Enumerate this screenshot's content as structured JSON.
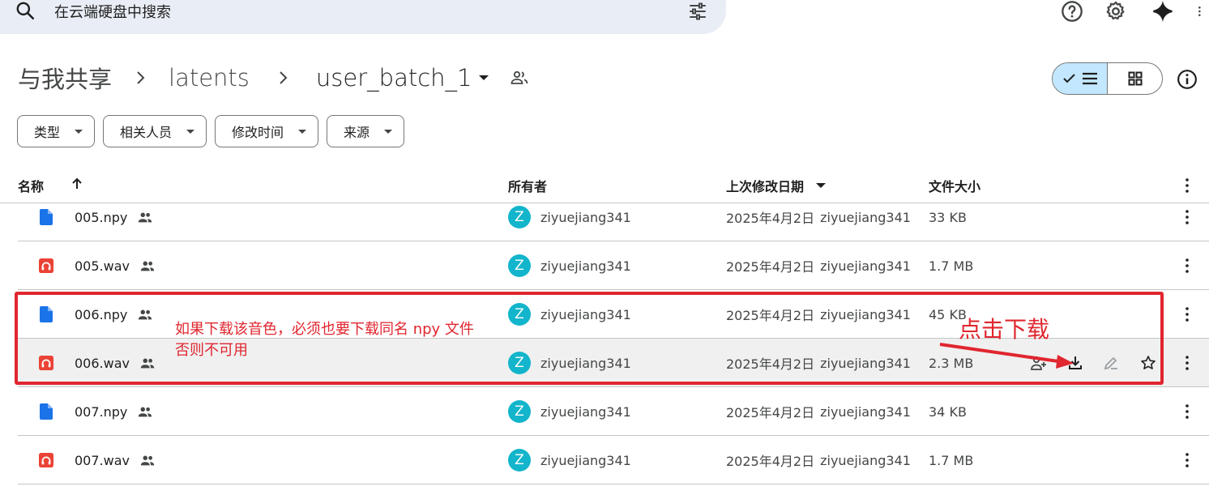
{
  "search": {
    "placeholder": "在云端硬盘中搜索"
  },
  "top_icons": [
    "search-icon",
    "tune-icon",
    "help-icon",
    "settings-icon",
    "gemini-icon",
    "apps-icon"
  ],
  "breadcrumb": {
    "items": [
      "与我共享",
      "latents",
      "user_batch_1"
    ]
  },
  "filters": [
    "类型",
    "相关人员",
    "修改时间",
    "来源"
  ],
  "table": {
    "headers": {
      "name": "名称",
      "owner": "所有者",
      "modified": "上次修改日期",
      "size": "文件大小"
    },
    "rows": [
      {
        "name": "005.npy",
        "type": "doc",
        "owner": "ziyuejiang341",
        "avatar": "Z",
        "date": "2025年4月2日",
        "modifier": "ziyuejiang341",
        "size": "33 KB"
      },
      {
        "name": "005.wav",
        "type": "audio",
        "owner": "ziyuejiang341",
        "avatar": "Z",
        "date": "2025年4月2日",
        "modifier": "ziyuejiang341",
        "size": "1.7 MB"
      },
      {
        "name": "006.npy",
        "type": "doc",
        "owner": "ziyuejiang341",
        "avatar": "Z",
        "date": "2025年4月2日",
        "modifier": "ziyuejiang341",
        "size": "45 KB"
      },
      {
        "name": "006.wav",
        "type": "audio",
        "owner": "ziyuejiang341",
        "avatar": "Z",
        "date": "2025年4月2日",
        "modifier": "ziyuejiang341",
        "size": "2.3 MB"
      },
      {
        "name": "007.npy",
        "type": "doc",
        "owner": "ziyuejiang341",
        "avatar": "Z",
        "date": "2025年4月2日",
        "modifier": "ziyuejiang341",
        "size": "34 KB"
      },
      {
        "name": "007.wav",
        "type": "audio",
        "owner": "ziyuejiang341",
        "avatar": "Z",
        "date": "2025年4月2日",
        "modifier": "ziyuejiang341",
        "size": "1.7 MB"
      }
    ]
  },
  "annotations": {
    "left_line1": "如果下载该音色，必须也要下载同名 npy 文件",
    "left_line2": "否则不可用",
    "right": "点击下载"
  },
  "colors": {
    "accent_blue": "#1a73e8",
    "audio_red": "#ea4335",
    "avatar_teal": "#12b5cb",
    "annotation_red": "#e0262f",
    "selected_toggle": "#c2e7ff"
  }
}
